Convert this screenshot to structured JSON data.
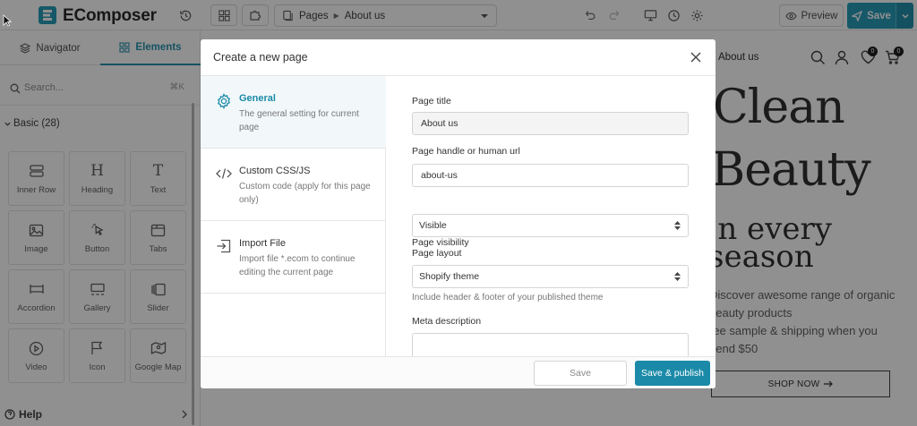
{
  "app": {
    "name": "EComposer"
  },
  "toolbar": {
    "pages_label": "Pages",
    "current_page": "About us",
    "preview_label": "Preview",
    "save_label": "Save"
  },
  "left_panel": {
    "tabs": [
      {
        "label": "Navigator",
        "icon": "layers-icon",
        "active": false
      },
      {
        "label": "Elements",
        "icon": "grid-icon",
        "active": true
      }
    ],
    "search": {
      "placeholder": "Search...",
      "shortcut": "⌘K"
    },
    "section_label": "Basic (28)",
    "elements": [
      {
        "label": "Inner Row",
        "icon": "inner-row-icon"
      },
      {
        "label": "Heading",
        "icon": "heading-icon"
      },
      {
        "label": "Text",
        "icon": "text-icon"
      },
      {
        "label": "Image",
        "icon": "image-icon"
      },
      {
        "label": "Button",
        "icon": "button-icon"
      },
      {
        "label": "Tabs",
        "icon": "tabs-icon"
      },
      {
        "label": "Accordion",
        "icon": "accordion-icon"
      },
      {
        "label": "Gallery",
        "icon": "gallery-icon"
      },
      {
        "label": "Slider",
        "icon": "slider-icon"
      },
      {
        "label": "Video",
        "icon": "video-icon"
      },
      {
        "label": "Icon",
        "icon": "flag-icon"
      },
      {
        "label": "Google Map",
        "icon": "map-icon"
      }
    ],
    "help_label": "Help"
  },
  "preview": {
    "nav_link": "About us",
    "wishlist_count": "0",
    "cart_count": "0",
    "headline_1": "Clean",
    "headline_2": "Beauty",
    "sub_1": "'n every",
    "sub_2": "season",
    "desc_1": "Discover awesome range of organic",
    "desc_2": "beauty products",
    "desc_3": "ree sample & shipping when you",
    "desc_4": "pend $50",
    "cta": "SHOP NOW"
  },
  "modal": {
    "title": "Create a new page",
    "sidebar": [
      {
        "title": "General",
        "desc": "The general setting for current page",
        "icon": "gear-icon",
        "active": true
      },
      {
        "title": "Custom CSS/JS",
        "desc": "Custom code (apply for this page only)",
        "icon": "code-icon",
        "active": false
      },
      {
        "title": "Import File",
        "desc": "Import file *.ecom to continue editing the current page",
        "icon": "import-icon",
        "active": false
      }
    ],
    "fields": {
      "page_title_label": "Page title",
      "page_title_value": "About us",
      "handle_label": "Page handle or human url",
      "handle_value": "about-us",
      "visibility_label": "Page visibility",
      "visibility_value": "Visible",
      "layout_label": "Page layout",
      "layout_value": "Shopify theme",
      "layout_hint": "Include header & footer of your published theme",
      "meta_label": "Meta description"
    },
    "buttons": {
      "save": "Save",
      "save_publish": "Save & publish"
    }
  },
  "colors": {
    "accent": "#1a95b4",
    "accent_dark": "#1a8aa8"
  }
}
